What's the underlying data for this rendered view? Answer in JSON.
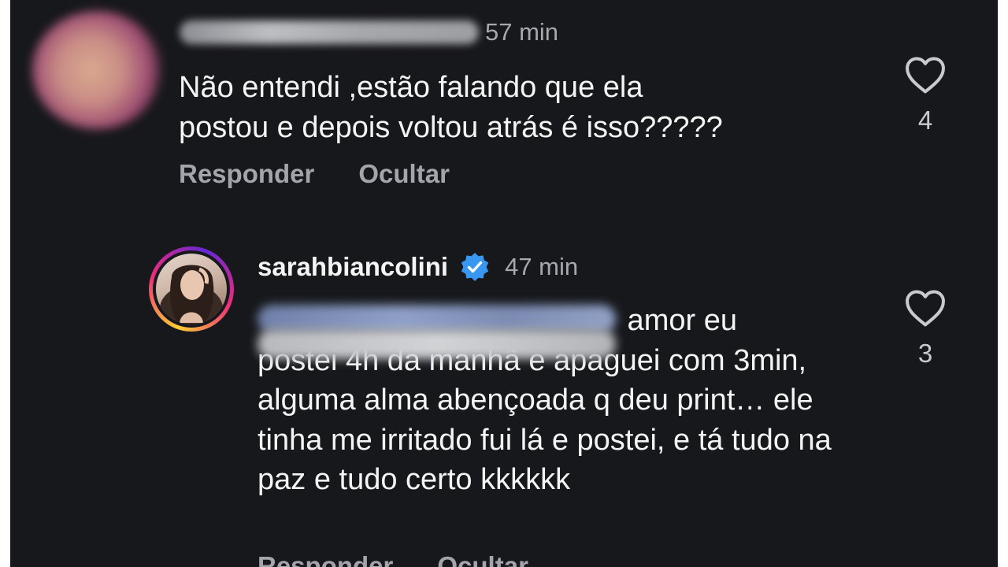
{
  "comments": [
    {
      "time": "57 min",
      "text": "Não entendi ,estão falando que ela\npostou e depois voltou atrás é isso?????",
      "reply_label": "Responder",
      "hide_label": "Ocultar",
      "likes": "4"
    }
  ],
  "reply": {
    "username": "sarahbiancolini",
    "verified": true,
    "time": "47 min",
    "text_line1_tail": " amor eu",
    "text_rest": "postei 4h da manhã e apaguei com 3min, alguma alma abençoada q deu print… ele tinha me irritado fui lá e postei, e tá tudo na paz e tudo certo kkkkkk",
    "reply_label": "Responder",
    "hide_label": "Ocultar",
    "likes": "3"
  },
  "colors": {
    "background": "#17181c",
    "secondary_text": "#a6a8ad",
    "verified_blue": "#3897f0"
  }
}
